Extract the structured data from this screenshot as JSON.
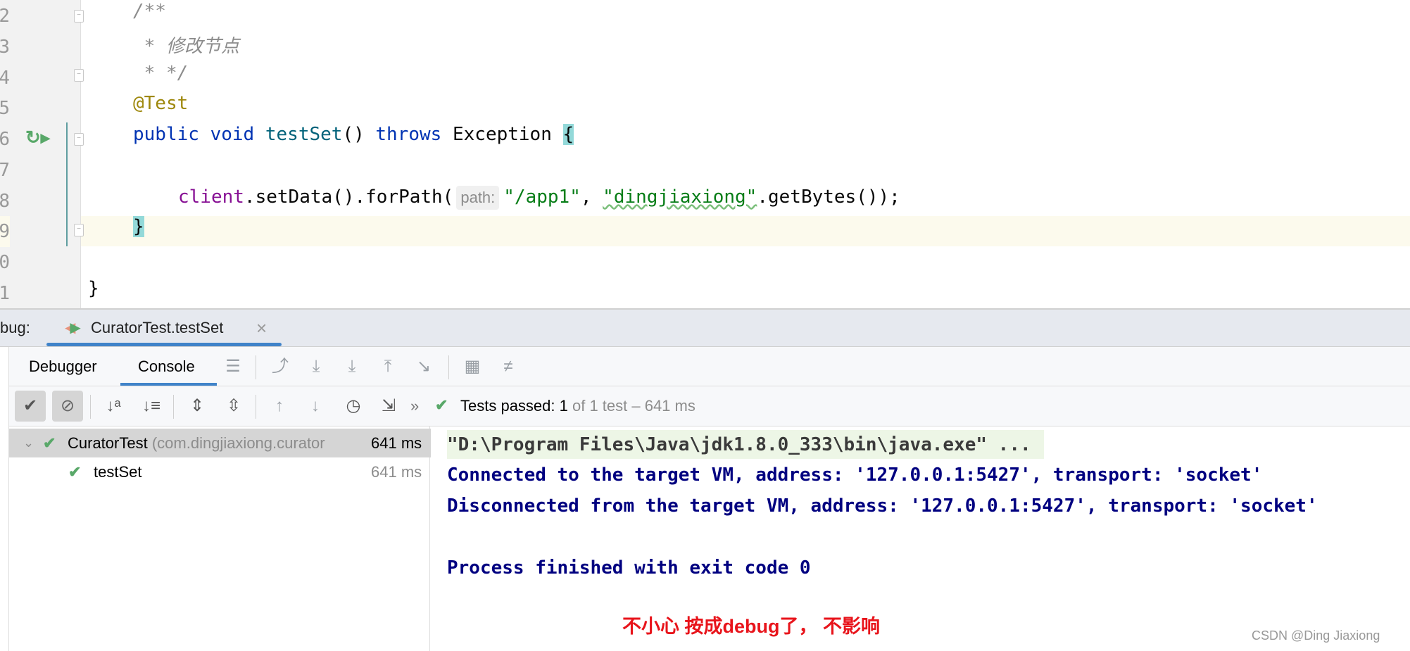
{
  "editor": {
    "line_numbers": [
      "2",
      "3",
      "4",
      "5",
      "6",
      "7",
      "8",
      "9",
      "0",
      "1"
    ],
    "comment_open": "/**",
    "comment_text": " * 修改节点",
    "comment_close": " * */",
    "annotation": "@Test",
    "kw_public": "public",
    "kw_void": "void",
    "method_name": "testSet",
    "method_parens": "()",
    "kw_throws": "throws",
    "exception": "Exception",
    "open_brace": "{",
    "client": "client",
    "call_chain": ".setData().forPath(",
    "param_hint": "path:",
    "arg1": "\"/app1\"",
    "comma": ", ",
    "arg2": "\"dingjiaxiong\"",
    "call_tail": ".getBytes());",
    "close_brace": "}",
    "class_close": "}"
  },
  "debug_panel": {
    "label": "bug:",
    "tab_title": "CuratorTest.testSet",
    "close": "×",
    "tabs": [
      "Debugger",
      "Console"
    ],
    "active_tab": "Console",
    "status_strong": "Tests passed: 1",
    "status_rest": " of 1 test – 641 ms",
    "more": "»"
  },
  "test_tree": [
    {
      "name": "CuratorTest",
      "package": " (com.dingjiaxiong.curator",
      "time": "641 ms",
      "status": "passed"
    },
    {
      "name": "testSet",
      "time": "641 ms",
      "status": "passed"
    }
  ],
  "console": {
    "lines": [
      "\"D:\\Program Files\\Java\\jdk1.8.0_333\\bin\\java.exe\" ...",
      "Connected to the target VM, address: '127.0.0.1:5427', transport: 'socket'",
      "Disconnected from the target VM, address: '127.0.0.1:5427', transport: 'socket'",
      "Process finished with exit code 0"
    ]
  },
  "annotation_note": "不小心 按成debug了， 不影响",
  "watermark": "CSDN @Ding Jiaxiong",
  "colors": {
    "accent": "#4083c9",
    "pass": "#59a869",
    "note": "#e8141b"
  }
}
